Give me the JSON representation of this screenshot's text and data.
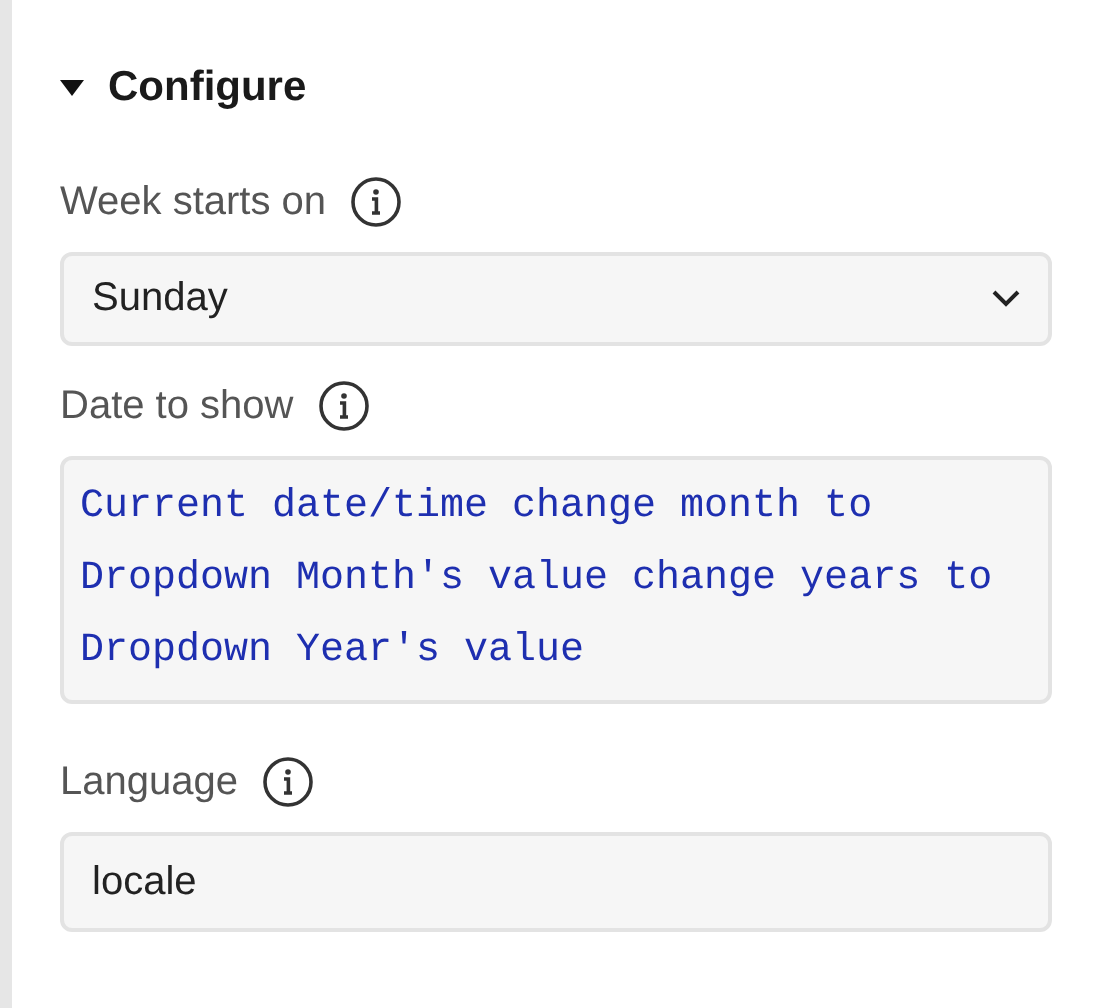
{
  "section": {
    "title": "Configure",
    "expanded": true
  },
  "fields": [
    {
      "kind": "select",
      "label": "Week starts on",
      "value": "Sunday"
    },
    {
      "kind": "code",
      "label": "Date to show",
      "value": "Current date/time change month to Dropdown Month's value change years to Dropdown Year's value"
    },
    {
      "kind": "text",
      "label": "Language",
      "value": "locale"
    }
  ]
}
